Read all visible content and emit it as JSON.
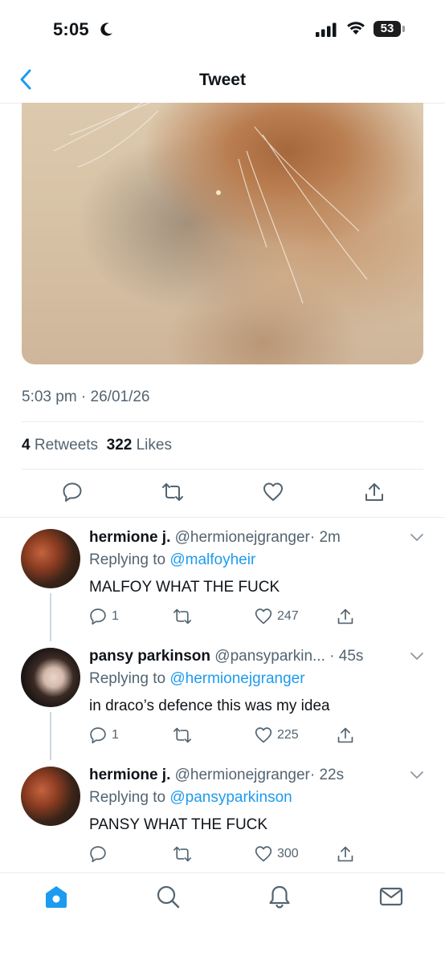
{
  "status_bar": {
    "time": "5:05",
    "battery": "53"
  },
  "nav": {
    "title": "Tweet"
  },
  "tweet": {
    "timestamp": "5:03 pm · 26/01/26",
    "retweets_count": "4",
    "retweets_label": "Retweets",
    "likes_count": "322",
    "likes_label": "Likes"
  },
  "replies": [
    {
      "name": "hermione j.",
      "handle": "@hermionejgranger",
      "time": "· 2m",
      "replying_prefix": "Replying to",
      "replying_to": "@malfoyheir",
      "text": "MALFOY WHAT THE FUCK",
      "reply_count": "1",
      "like_count": "247"
    },
    {
      "name": "pansy parkinson",
      "handle": "@pansyparkin...",
      "time": "· 45s",
      "replying_prefix": "Replying to",
      "replying_to": "@hermionejgranger",
      "text": "in draco’s defence this was my idea",
      "reply_count": "1",
      "like_count": "225"
    },
    {
      "name": "hermione j.",
      "handle": "@hermionejgranger",
      "time": "· 22s",
      "replying_prefix": "Replying to",
      "replying_to": "@pansyparkinson",
      "text": "PANSY WHAT THE FUCK",
      "reply_count": "",
      "like_count": "300"
    }
  ],
  "tab_bar": {
    "items": [
      "home-icon",
      "search-icon",
      "notifications-icon",
      "messages-icon"
    ]
  },
  "colors": {
    "accent": "#1d9bf0",
    "secondary_text": "#536471",
    "border": "#e6ecf0"
  }
}
